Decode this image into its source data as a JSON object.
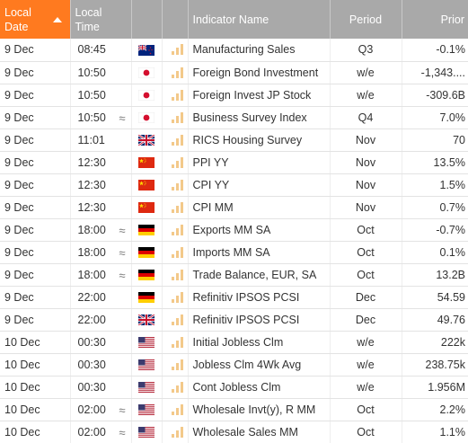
{
  "headers": {
    "local_date": "Local Date",
    "local_time": "Local Time",
    "indicator_name": "Indicator Name",
    "period": "Period",
    "prior": "Prior"
  },
  "colors": {
    "active_header": "#ff7a1f",
    "header": "#a9a9a9",
    "bars": "#f3c98a"
  },
  "rows": [
    {
      "date": "9 Dec",
      "time": "08:45",
      "approx": "",
      "flag": "nz-flag-icon",
      "name": "Manufacturing Sales",
      "period": "Q3",
      "prior": "-0.1%"
    },
    {
      "date": "9 Dec",
      "time": "10:50",
      "approx": "",
      "flag": "jp-flag-icon",
      "name": "Foreign Bond Investment",
      "period": "w/e",
      "prior": "-1,343...."
    },
    {
      "date": "9 Dec",
      "time": "10:50",
      "approx": "",
      "flag": "jp-flag-icon",
      "name": "Foreign Invest JP Stock",
      "period": "w/e",
      "prior": "-309.6B"
    },
    {
      "date": "9 Dec",
      "time": "10:50",
      "approx": "≈",
      "flag": "jp-flag-icon",
      "name": "Business Survey Index",
      "period": "Q4",
      "prior": "7.0%"
    },
    {
      "date": "9 Dec",
      "time": "11:01",
      "approx": "",
      "flag": "gb-flag-icon",
      "name": "RICS Housing Survey",
      "period": "Nov",
      "prior": "70"
    },
    {
      "date": "9 Dec",
      "time": "12:30",
      "approx": "",
      "flag": "cn-flag-icon",
      "name": "PPI YY",
      "period": "Nov",
      "prior": "13.5%"
    },
    {
      "date": "9 Dec",
      "time": "12:30",
      "approx": "",
      "flag": "cn-flag-icon",
      "name": "CPI YY",
      "period": "Nov",
      "prior": "1.5%"
    },
    {
      "date": "9 Dec",
      "time": "12:30",
      "approx": "",
      "flag": "cn-flag-icon",
      "name": "CPI MM",
      "period": "Nov",
      "prior": "0.7%"
    },
    {
      "date": "9 Dec",
      "time": "18:00",
      "approx": "≈",
      "flag": "de-flag-icon",
      "name": "Exports MM SA",
      "period": "Oct",
      "prior": "-0.7%"
    },
    {
      "date": "9 Dec",
      "time": "18:00",
      "approx": "≈",
      "flag": "de-flag-icon",
      "name": "Imports MM SA",
      "period": "Oct",
      "prior": "0.1%"
    },
    {
      "date": "9 Dec",
      "time": "18:00",
      "approx": "≈",
      "flag": "de-flag-icon",
      "name": "Trade Balance, EUR, SA",
      "period": "Oct",
      "prior": "13.2B"
    },
    {
      "date": "9 Dec",
      "time": "22:00",
      "approx": "",
      "flag": "de-flag-icon",
      "name": "Refinitiv IPSOS PCSI",
      "period": "Dec",
      "prior": "54.59"
    },
    {
      "date": "9 Dec",
      "time": "22:00",
      "approx": "",
      "flag": "gb-flag-icon",
      "name": "Refinitiv IPSOS PCSI",
      "period": "Dec",
      "prior": "49.76"
    },
    {
      "date": "10 Dec",
      "time": "00:30",
      "approx": "",
      "flag": "us-flag-icon",
      "name": "Initial Jobless Clm",
      "period": "w/e",
      "prior": "222k"
    },
    {
      "date": "10 Dec",
      "time": "00:30",
      "approx": "",
      "flag": "us-flag-icon",
      "name": "Jobless Clm 4Wk Avg",
      "period": "w/e",
      "prior": "238.75k"
    },
    {
      "date": "10 Dec",
      "time": "00:30",
      "approx": "",
      "flag": "us-flag-icon",
      "name": "Cont Jobless Clm",
      "period": "w/e",
      "prior": "1.956M"
    },
    {
      "date": "10 Dec",
      "time": "02:00",
      "approx": "≈",
      "flag": "us-flag-icon",
      "name": "Wholesale Invt(y), R MM",
      "period": "Oct",
      "prior": "2.2%"
    },
    {
      "date": "10 Dec",
      "time": "02:00",
      "approx": "≈",
      "flag": "us-flag-icon",
      "name": "Wholesale Sales MM",
      "period": "Oct",
      "prior": "1.1%"
    }
  ]
}
